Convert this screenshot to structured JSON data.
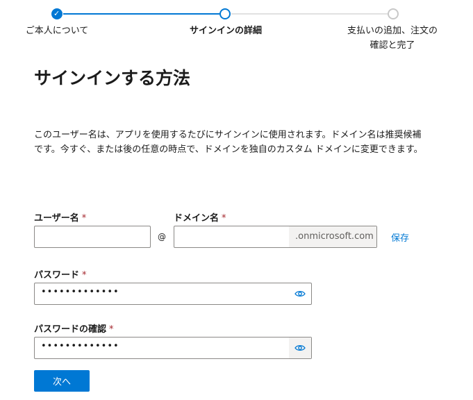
{
  "stepper": {
    "steps": [
      {
        "label": "ご本人について",
        "state": "complete"
      },
      {
        "label": "サインインの詳細",
        "state": "current"
      },
      {
        "label": "支払いの追加、注文の\n確認と完了",
        "state": "pending"
      }
    ]
  },
  "page": {
    "title": "サインインする方法",
    "description": "このユーザー名は、アプリを使用するたびにサインインに使用されます。ドメイン名は推奨候補です。今すぐ、または後の任意の時点で、ドメインを独自のカスタム ドメインに変更できます。"
  },
  "form": {
    "username_label": "ユーザー名",
    "username_value": "",
    "at_symbol": "@",
    "domain_label": "ドメイン名",
    "domain_value": "",
    "domain_suffix": ".onmicrosoft.com",
    "save_link": "保存",
    "password_label": "パスワード",
    "password_masked": "•••••••••••••",
    "confirm_label": "パスワードの確認",
    "confirm_masked": "•••••••••••••",
    "required_mark": "*",
    "next_button": "次へ"
  },
  "colors": {
    "accent": "#0078d4",
    "required": "#a4262c"
  }
}
